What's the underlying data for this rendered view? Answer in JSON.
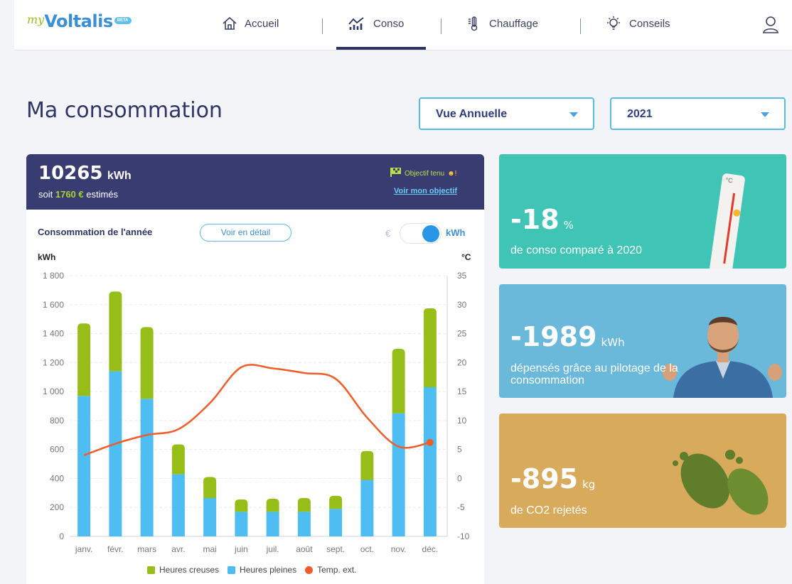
{
  "brand": {
    "prefix": "my",
    "name": "Voltalis",
    "badge": "BETA"
  },
  "nav": [
    {
      "label": "Accueil",
      "icon": "home-icon"
    },
    {
      "label": "Conso",
      "icon": "chart-icon"
    },
    {
      "label": "Chauffage",
      "icon": "thermometer-icon"
    },
    {
      "label": "Conseils",
      "icon": "lightbulb-icon"
    }
  ],
  "user_icon": "user-icon",
  "page": {
    "title": "Ma consommation"
  },
  "filters": {
    "view": "Vue Annuelle",
    "year": "2021"
  },
  "summary": {
    "total": "10265",
    "total_unit": "kWh",
    "prefix": "soit",
    "cost": "1760 €",
    "suffix": "estimés",
    "objective_status": "Objectif tenu",
    "objective_link": "Voir mon objectif"
  },
  "chart_header": {
    "title": "Consommation de l'année",
    "detail_button": "Voir en détail",
    "toggle_left": "€",
    "toggle_right": "kWh",
    "toggle_state": "kWh"
  },
  "chart_data": {
    "type": "bar",
    "categories": [
      "janv.",
      "févr.",
      "mars",
      "avr.",
      "mai",
      "juin",
      "juil.",
      "août",
      "sept.",
      "oct.",
      "nov.",
      "déc."
    ],
    "series": [
      {
        "name": "Heures pleines",
        "color": "#4dbdf2",
        "values": [
          970,
          1140,
          950,
          430,
          265,
          170,
          170,
          170,
          190,
          390,
          850,
          1030
        ]
      },
      {
        "name": "Heures creuses",
        "color": "#97bd19",
        "values": [
          500,
          550,
          495,
          205,
          145,
          85,
          90,
          95,
          90,
          200,
          445,
          545
        ]
      }
    ],
    "line_series": {
      "name": "Temp. ext.",
      "color": "#ef5d2b",
      "axis": "right",
      "values": [
        4,
        6,
        7.5,
        8.5,
        13,
        19.2,
        19,
        18.2,
        17.2,
        10.5,
        5.5,
        6.2
      ]
    },
    "xlabel": "",
    "ylabel": "kWh",
    "y2label": "°C",
    "ylim": [
      0,
      1800
    ],
    "y2lim": [
      -10,
      35
    ],
    "yticks": [
      "1 800",
      "1 600",
      "1 400",
      "1 200",
      "1 000",
      "800",
      "600",
      "400",
      "200",
      "0"
    ],
    "y2ticks": [
      "35",
      "30",
      "25",
      "20",
      "15",
      "10",
      "5",
      "0",
      "-5",
      "-10"
    ],
    "grid": true,
    "legend": "bottom"
  },
  "kpis": [
    {
      "value": "-18",
      "unit": "%",
      "text": "de conso comparé à 2020",
      "bg": "#3fc4b5",
      "icon": "thermometer-photo"
    },
    {
      "value": "-1989",
      "unit": "kWh",
      "text": "dépensés grâce au pilotage de la consommation",
      "bg": "#6ab8da",
      "icon": "meditating-man-photo"
    },
    {
      "value": "-895",
      "unit": "kg",
      "text": "de CO2 rejetés",
      "bg": "#d8ab5c",
      "icon": "footprints-photo"
    }
  ]
}
